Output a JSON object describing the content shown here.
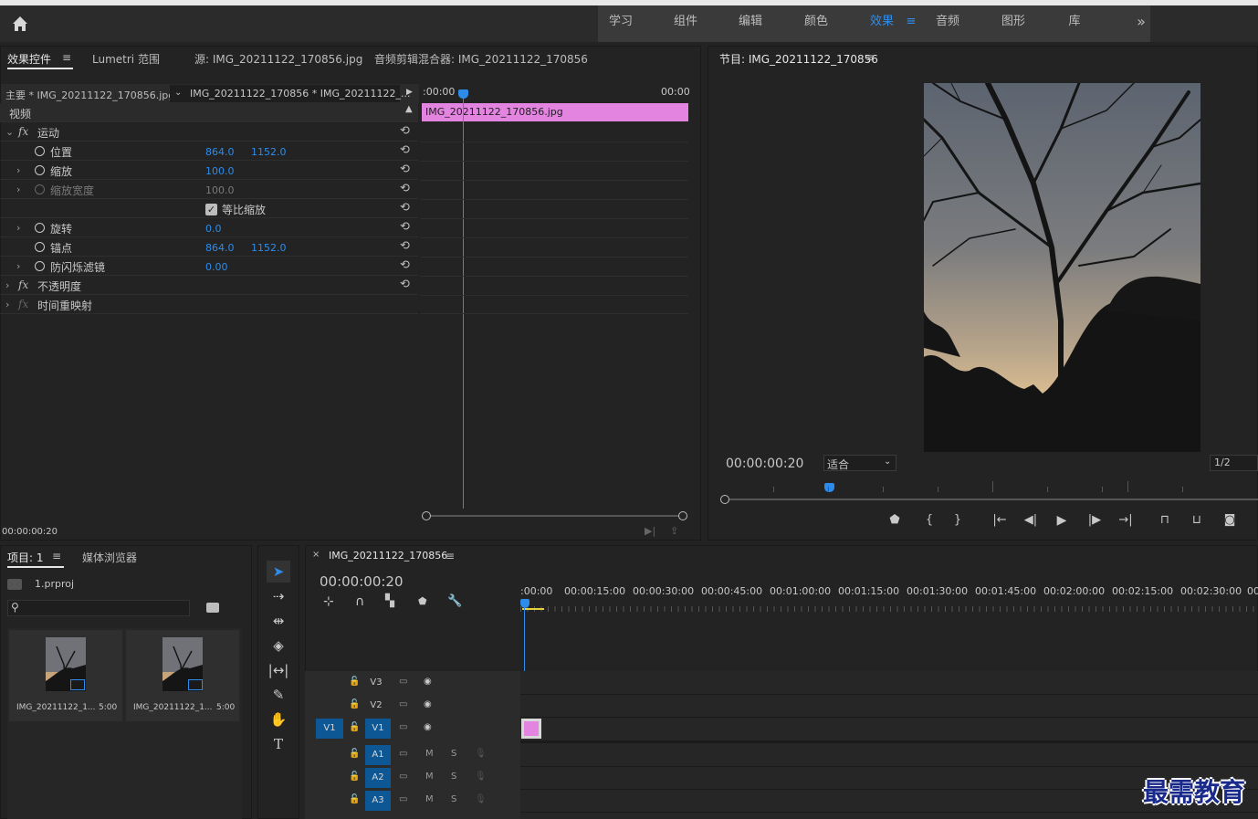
{
  "workspaces": {
    "items": [
      "学习",
      "组件",
      "编辑",
      "颜色",
      "效果",
      "音频",
      "图形",
      "库"
    ],
    "active_index": 4,
    "more": "»"
  },
  "effect_controls": {
    "tabs": [
      "效果控件",
      "Lumetri 范围",
      "源: IMG_20211122_170856.jpg",
      "音频剪辑混合器: IMG_20211122_170856"
    ],
    "master_clip": "主要 * IMG_20211122_170856.jpg",
    "sequence_clip": "IMG_20211122_170856 * IMG_20211122_...",
    "timecode_start": ":00:00",
    "timecode_end": "00:00",
    "clip_bar_label": "IMG_20211122_170856.jpg",
    "section_video": "视频",
    "motion": "运动",
    "position_label": "位置",
    "position_x": "864.0",
    "position_y": "1152.0",
    "scale_label": "缩放",
    "scale_value": "100.0",
    "scale_width_label": "缩放宽度",
    "scale_width_value": "100.0",
    "uniform_scale_label": "等比缩放",
    "rotation_label": "旋转",
    "rotation_value": "0.0",
    "anchor_label": "锚点",
    "anchor_x": "864.0",
    "anchor_y": "1152.0",
    "antiflicker_label": "防闪烁滤镜",
    "antiflicker_value": "0.00",
    "opacity": "不透明度",
    "time_remap": "时间重映射",
    "footer_timecode": "00:00:00:20",
    "colors": {
      "clip": "#e384e0",
      "accent": "#2d8ceb"
    }
  },
  "program": {
    "title": "节目: IMG_20211122_170856",
    "timecode": "00:00:00:20",
    "fit_label": "适合",
    "resolution": "1/2"
  },
  "project": {
    "tab_project": "项目: 1",
    "tab_media": "媒体浏览器",
    "file": "1.prproj",
    "items": [
      {
        "name": "IMG_20211122_1...",
        "duration": "5:00"
      },
      {
        "name": "IMG_20211122_1...",
        "duration": "5:00"
      }
    ]
  },
  "timeline": {
    "sequence_name": "IMG_20211122_170856",
    "timecode": "00:00:00:20",
    "ruler": [
      ":00:00",
      "00:00:15:00",
      "00:00:30:00",
      "00:00:45:00",
      "00:01:00:00",
      "00:01:15:00",
      "00:01:30:00",
      "00:01:45:00",
      "00:02:00:00",
      "00:02:15:00",
      "00:02:30:00",
      "00"
    ],
    "video_tracks": [
      "V3",
      "V2",
      "V1"
    ],
    "source_patch": "V1",
    "audio_tracks": [
      "A1",
      "A2",
      "A3"
    ],
    "mute": "M",
    "solo": "S"
  },
  "watermark": "最需教育"
}
